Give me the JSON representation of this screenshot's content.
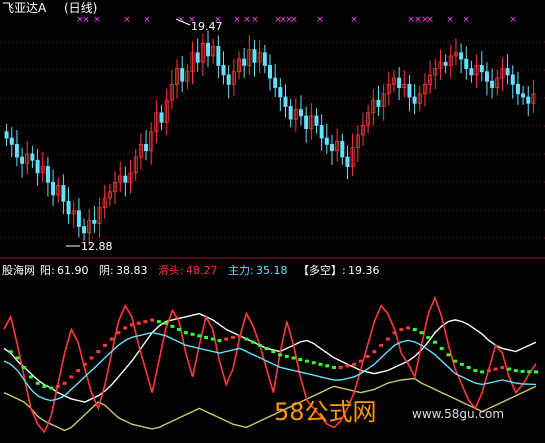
{
  "header": {
    "title": "飞亚达A",
    "period": "(日线)"
  },
  "main_panel": {
    "high_label": "19.47",
    "low_label": "12.88"
  },
  "indicator_panel": {
    "name": "股海网",
    "items": [
      {
        "label": "阳:",
        "value": "61.90",
        "color": "#ffffff"
      },
      {
        "label": "阴:",
        "value": "38.83",
        "color": "#ffffff"
      },
      {
        "label": "滑头:",
        "value": "48.27",
        "color": "#ff3030"
      },
      {
        "label": "主力:",
        "value": "35.18",
        "color": "#66e0ff"
      },
      {
        "label": "【多空】:",
        "value": "19.36",
        "color": "#ffffff"
      }
    ]
  },
  "watermark": {
    "brand": "58公式网",
    "url": "www.58gu.com"
  },
  "colors": {
    "up": "#ff3a3a",
    "down": "#66e0ff",
    "grid": "#7a1010",
    "marker": "#ff44ff",
    "signal_green": "#33ff33",
    "cyan_line": "#66e0ff",
    "white_line": "#ffffff"
  },
  "chart_data": [
    {
      "type": "candlestick",
      "title": "飞亚达A (日线)",
      "annotations": [
        "19.47",
        "12.88"
      ],
      "price_range": [
        12.5,
        20.0
      ],
      "close": [
        16.2,
        16.0,
        15.6,
        15.4,
        15.7,
        15.5,
        15.1,
        15.3,
        14.8,
        14.4,
        14.7,
        14.2,
        13.8,
        13.9,
        13.4,
        13.2,
        13.6,
        13.5,
        14.0,
        14.3,
        14.5,
        14.8,
        15.0,
        14.8,
        15.1,
        15.6,
        16.0,
        15.8,
        16.4,
        17.0,
        16.7,
        17.4,
        17.9,
        18.4,
        18.0,
        18.3,
        18.9,
        18.6,
        19.2,
        18.8,
        19.1,
        18.5,
        18.2,
        17.9,
        18.3,
        18.7,
        18.5,
        19.0,
        18.6,
        18.9,
        18.5,
        18.1,
        17.8,
        17.5,
        17.2,
        16.8,
        17.1,
        16.9,
        16.5,
        16.9,
        16.6,
        16.2,
        16.0,
        15.8,
        16.1,
        15.6,
        15.3,
        15.9,
        16.3,
        16.6,
        17.0,
        17.4,
        17.2,
        17.6,
        17.9,
        18.1,
        17.8,
        17.9,
        17.5,
        17.3,
        17.6,
        17.9,
        18.2,
        18.4,
        18.6,
        18.5,
        18.8,
        18.9,
        18.7,
        18.4,
        18.2,
        18.5,
        18.3,
        18.0,
        17.8,
        18.1,
        18.4,
        18.2,
        17.9,
        17.6,
        17.5,
        17.3,
        17.6
      ]
    },
    {
      "type": "line",
      "title": "股海网",
      "ylim": [
        0,
        100
      ],
      "series": [
        {
          "name": "阳",
          "values": [
            58,
            55,
            50,
            46,
            42,
            38,
            35,
            33,
            30,
            28,
            26,
            25,
            24,
            26,
            28,
            31,
            35,
            40,
            45,
            50,
            56,
            62,
            68,
            72,
            75,
            76,
            77,
            78,
            79,
            80,
            78,
            76,
            73,
            70,
            68,
            66,
            64,
            62,
            60,
            58,
            57,
            56,
            58,
            60,
            62,
            63,
            61,
            58,
            55,
            52,
            50,
            48,
            46,
            44,
            43,
            42,
            43,
            44,
            46,
            48,
            50,
            53,
            57,
            62,
            68,
            72,
            75,
            76,
            75,
            73,
            70,
            67,
            63,
            60,
            58,
            57,
            56,
            58,
            60,
            61.9
          ]
        },
        {
          "name": "阴",
          "values": [
            30,
            28,
            26,
            24,
            20,
            15,
            12,
            10,
            8,
            6,
            8,
            12,
            16,
            20,
            24,
            22,
            18,
            14,
            12,
            10,
            9,
            8,
            7,
            8,
            10,
            12,
            14,
            16,
            18,
            20,
            18,
            16,
            14,
            12,
            10,
            9,
            8,
            10,
            12,
            14,
            16,
            18,
            20,
            22,
            24,
            26,
            28,
            30,
            32,
            34,
            33,
            32,
            31,
            30,
            31,
            32,
            34,
            36,
            37,
            38,
            38.5,
            38.83,
            36,
            34,
            32,
            30,
            28,
            26,
            24,
            22,
            20,
            18,
            20,
            22,
            24,
            26,
            28,
            30,
            32,
            34
          ]
        },
        {
          "name": "滑头",
          "values": [
            70,
            78,
            60,
            40,
            20,
            10,
            5,
            15,
            35,
            55,
            70,
            62,
            45,
            30,
            20,
            35,
            55,
            75,
            85,
            78,
            60,
            45,
            30,
            50,
            70,
            82,
            75,
            55,
            40,
            60,
            78,
            70,
            50,
            35,
            45,
            65,
            80,
            72,
            60,
            45,
            30,
            55,
            75,
            60,
            40,
            25,
            20,
            15,
            10,
            8,
            12,
            20,
            30,
            45,
            60,
            75,
            85,
            80,
            70,
            55,
            48.27,
            40,
            60,
            80,
            90,
            78,
            60,
            45,
            35,
            25,
            20,
            30,
            45,
            60,
            55,
            40,
            30,
            35,
            42,
            48.27
          ]
        },
        {
          "name": "主力",
          "values": [
            50,
            48,
            44,
            38,
            32,
            28,
            26,
            25,
            26,
            28,
            32,
            36,
            40,
            44,
            48,
            52,
            56,
            60,
            63,
            65,
            66,
            67,
            68,
            67,
            66,
            64,
            62,
            60,
            59,
            58,
            57,
            56,
            55,
            56,
            57,
            58,
            56,
            54,
            52,
            50,
            48,
            46,
            45,
            44,
            43,
            42,
            41,
            40,
            39,
            38,
            38,
            39,
            40,
            42,
            45,
            48,
            52,
            56,
            60,
            62,
            63,
            62,
            60,
            57,
            54,
            50,
            46,
            42,
            40,
            38,
            36,
            35.18,
            36,
            37,
            38,
            37,
            36,
            35.5,
            35.3,
            35.18
          ]
        }
      ]
    }
  ]
}
